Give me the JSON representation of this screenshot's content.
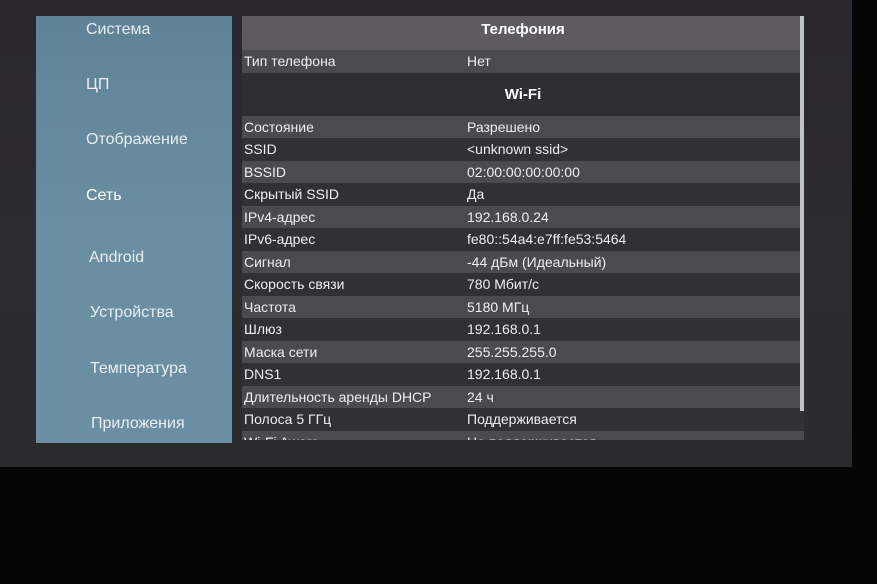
{
  "sidebar": {
    "items": [
      "Система",
      "ЦП",
      "Отображение",
      "Сеть",
      "Android",
      "Устройства",
      "Температура",
      "Приложения"
    ]
  },
  "telephony": {
    "title": "Телефония",
    "rows": [
      {
        "k": "Тип телефона",
        "v": "Нет"
      }
    ]
  },
  "wifi": {
    "title": "Wi-Fi",
    "rows": [
      {
        "k": "Состояние",
        "v": "Разрешено"
      },
      {
        "k": "SSID",
        "v": "<unknown ssid>"
      },
      {
        "k": "BSSID",
        "v": "02:00:00:00:00:00"
      },
      {
        "k": "Скрытый SSID",
        "v": "Да"
      },
      {
        "k": "IPv4-адрес",
        "v": "192.168.0.24"
      },
      {
        "k": "IPv6-адрес",
        "v": "fe80::54a4:e7ff:fe53:5464"
      },
      {
        "k": "Сигнал",
        "v": "-44 дБм (Идеальный)"
      },
      {
        "k": "Скорость связи",
        "v": "780 Мбит/с"
      },
      {
        "k": "Частота",
        "v": "5180 МГц"
      },
      {
        "k": "Шлюз",
        "v": "192.168.0.1"
      },
      {
        "k": "Маска сети",
        "v": "255.255.255.0"
      },
      {
        "k": "DNS1",
        "v": "192.168.0.1"
      },
      {
        "k": "Длительность аренды DHCP",
        "v": "24 ч"
      },
      {
        "k": "Полоса 5 ГГц",
        "v": "Поддерживается"
      },
      {
        "k": "Wi-Fi Aware",
        "v": "Не поддерживается"
      }
    ]
  }
}
